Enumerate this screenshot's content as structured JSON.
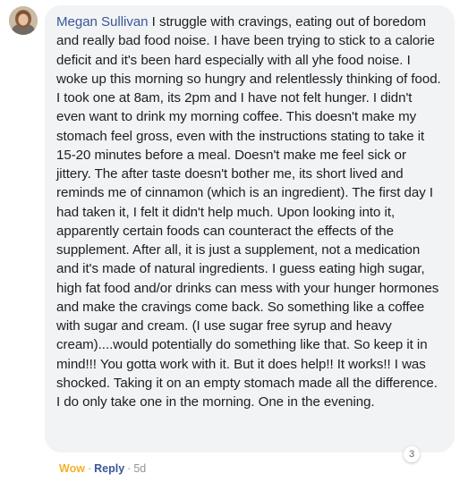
{
  "comment": {
    "author": "Megan Sullivan",
    "text": "I struggle with cravings, eating out of boredom and really bad food noise. I have been trying to stick to a calorie deficit and it's been hard especially with all yhe food noise. I woke up this morning so hungry and relentlessly thinking of food. I took one at 8am, its 2pm and I have not felt hunger. I didn't even want to drink my morning coffee. This doesn't make my stomach feel gross, even with the instructions stating to take it 15-20 minutes before a meal. Doesn't make me feel sick or jittery. The after taste doesn't bother me, its short lived and reminds me of cinnamon (which is an ingredient). The first day I had taken it, I felt it didn't help much. Upon looking into it, apparently certain foods can counteract the effects of the supplement. After all, it is just a supplement, not a medication and it's made of natural ingredients. I guess eating high sugar, high fat food and/or drinks can mess with your hunger hormones and make the cravings come back. So something like a coffee with sugar and cream. (I use sugar free syrup and heavy cream)....would potentially do something like that. So keep it in mind!!! You gotta work with it. But it does help!! It works!! I was shocked. Taking it on an empty stomach made all the difference. I do only take one in the morning. One in the evening.",
    "reaction_count": "3",
    "actions": {
      "wow_label": "Wow",
      "reply_label": "Reply",
      "separator": "·",
      "timestamp": "5d"
    }
  },
  "colors": {
    "author_link": "#385898",
    "bubble_background": "#f2f3f5",
    "wow_reaction": "#f7b125",
    "meta_gray": "#90949c"
  }
}
